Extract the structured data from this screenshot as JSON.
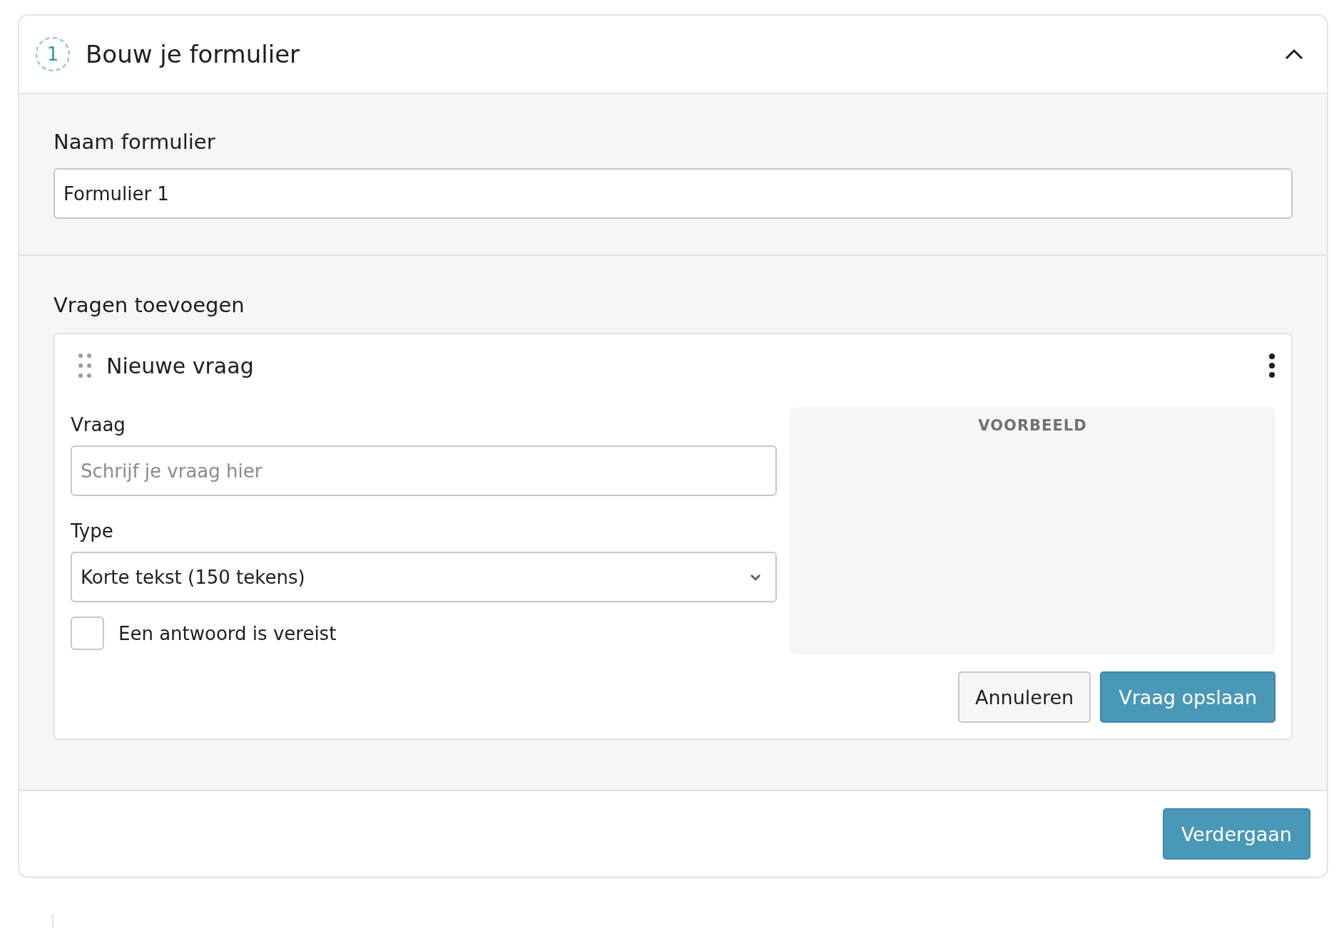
{
  "step": {
    "number": "1",
    "title": "Bouw je formulier",
    "expanded": true
  },
  "form_name": {
    "label": "Naam formulier",
    "value": "Formulier 1"
  },
  "questions_section": {
    "title": "Vragen toevoegen",
    "question": {
      "title": "Nieuwe vraag",
      "question_field": {
        "label": "Vraag",
        "placeholder": "Schrijf je vraag hier"
      },
      "type_field": {
        "label": "Type",
        "value": "Korte tekst (150 tekens)"
      },
      "required": {
        "label": "Een antwoord is vereist",
        "checked": false
      },
      "preview": {
        "title": "VOORBEELD"
      },
      "buttons": [
        {
          "label": "Annuleren",
          "kind": "secondary"
        },
        {
          "label": "Vraag opslaan",
          "kind": "primary"
        }
      ]
    }
  },
  "footer": {
    "button": "Verdergaan"
  }
}
